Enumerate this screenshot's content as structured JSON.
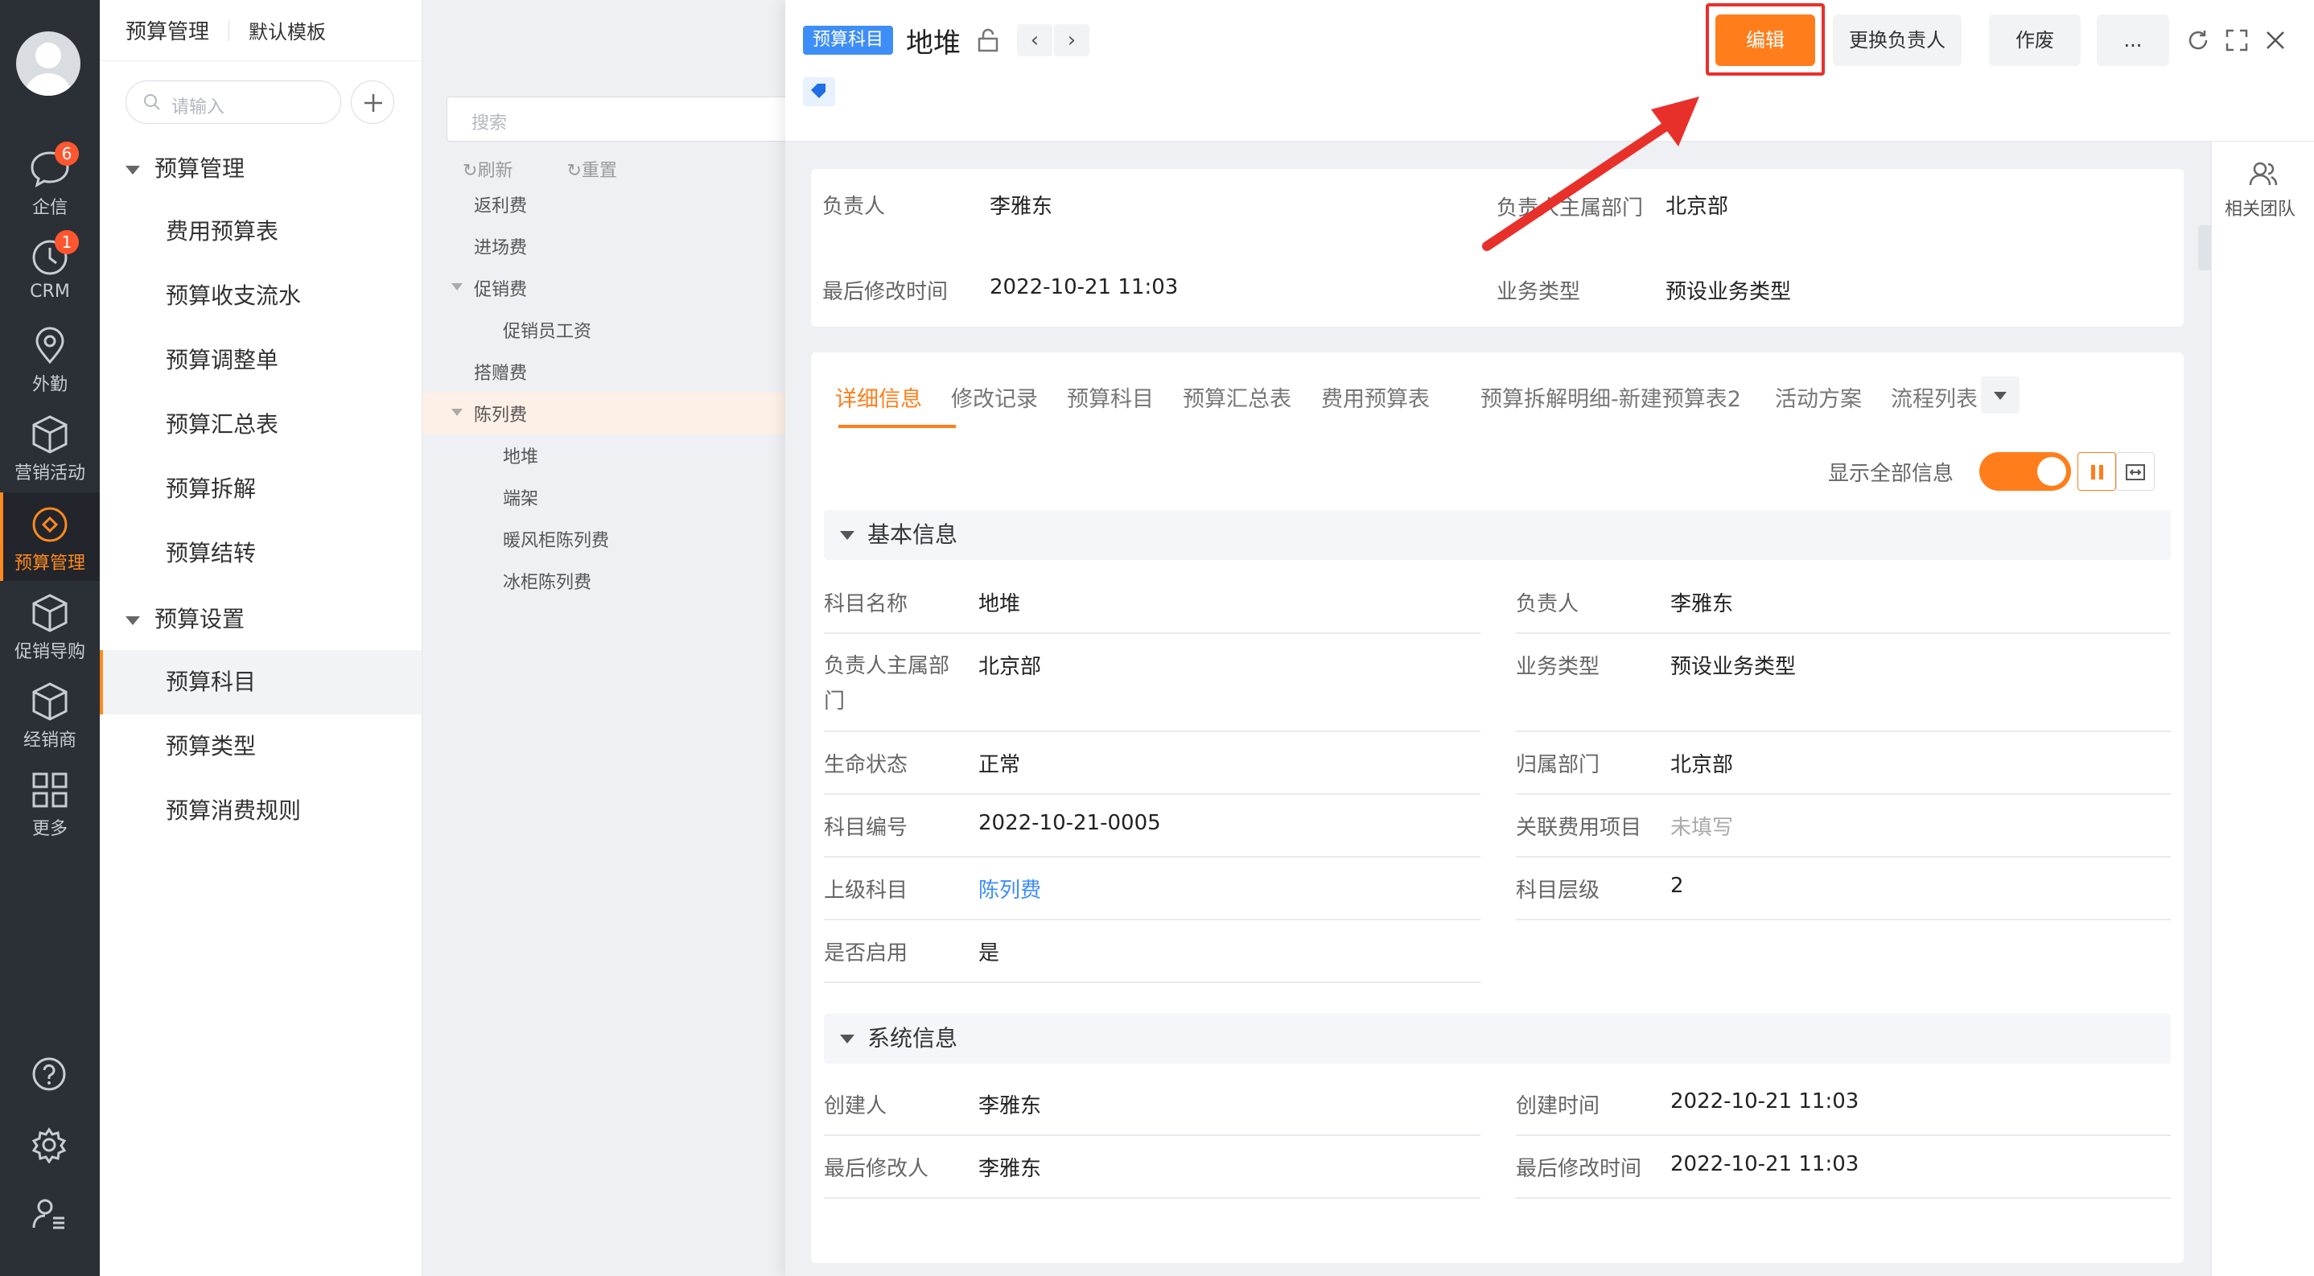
{
  "rail": {
    "items": [
      {
        "label": "企信",
        "badge": "6"
      },
      {
        "label": "CRM",
        "badge": "1"
      },
      {
        "label": "外勤"
      },
      {
        "label": "营销活动"
      },
      {
        "label": "预算管理"
      },
      {
        "label": "促销导购"
      },
      {
        "label": "经销商"
      },
      {
        "label": "更多"
      }
    ],
    "accent": "#ff8a1f"
  },
  "menu": {
    "title": "预算管理",
    "template": "默认模板",
    "search_placeholder": "请输入",
    "group1": "预算管理",
    "items1": [
      "费用预算表",
      "预算收支流水",
      "预算调整单",
      "预算汇总表",
      "预算拆解",
      "预算结转"
    ],
    "group2": "预算设置",
    "items2": [
      "预算科目",
      "预算类型",
      "预算消费规则"
    ]
  },
  "tree": {
    "search_placeholder": "搜索",
    "refresh": "刷新",
    "reset": "重置",
    "nodes": [
      "返利费",
      "进场费",
      "促销费",
      "促销员工资",
      "搭赠费",
      "陈列费",
      "地堆",
      "端架",
      "暖风柜陈列费",
      "冰柜陈列费"
    ]
  },
  "header": {
    "category_tag": "预算科目",
    "title": "地堆",
    "buttons": {
      "edit": "编辑",
      "change_owner": "更换负责人",
      "void": "作废",
      "more": "..."
    }
  },
  "summary": {
    "owner_label": "负责人",
    "owner": "李雅东",
    "dept_label": "负责人主属部门",
    "dept": "北京部",
    "modified_label": "最后修改时间",
    "modified": "2022-10-21 11:03",
    "biz_label": "业务类型",
    "biz": "预设业务类型"
  },
  "tabs": [
    "详细信息",
    "修改记录",
    "预算科目",
    "预算汇总表",
    "费用预算表",
    "预算拆解明细-新建预算表2",
    "活动方案",
    "流程列表"
  ],
  "show_all_label": "显示全部信息",
  "show_all": true,
  "basic": {
    "title": "基本信息",
    "left": [
      {
        "label": "科目名称",
        "value": "地堆"
      },
      {
        "label": "负责人主属部门",
        "value": "北京部"
      },
      {
        "label": "生命状态",
        "value": "正常"
      },
      {
        "label": "科目编号",
        "value": "2022-10-21-0005"
      },
      {
        "label": "上级科目",
        "value": "陈列费"
      },
      {
        "label": "是否启用",
        "value": "是"
      }
    ],
    "right": [
      {
        "label": "负责人",
        "value": "李雅东"
      },
      {
        "label": "业务类型",
        "value": "预设业务类型"
      },
      {
        "label": "归属部门",
        "value": "北京部"
      },
      {
        "label": "关联费用项目",
        "value": "未填写"
      },
      {
        "label": "科目层级",
        "value": "2"
      }
    ]
  },
  "system": {
    "title": "系统信息",
    "left": [
      {
        "label": "创建人",
        "value": "李雅东"
      },
      {
        "label": "最后修改人",
        "value": "李雅东"
      }
    ],
    "right": [
      {
        "label": "创建时间",
        "value": "2022-10-21 11:03"
      },
      {
        "label": "最后修改时间",
        "value": "2022-10-21 11:03"
      }
    ]
  },
  "team_label": "相关团队",
  "colors": {
    "primary": "#ff7d1a",
    "link": "#3e8ef7",
    "annotation": "#e8302b"
  }
}
